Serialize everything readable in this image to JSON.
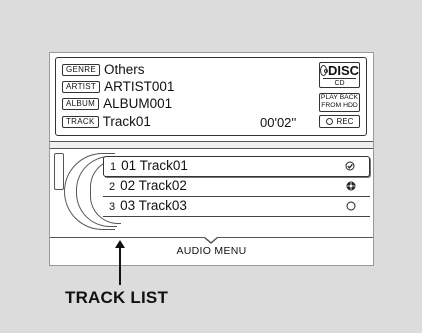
{
  "info": {
    "genre": {
      "tag": "GENRE",
      "value": "Others"
    },
    "artist": {
      "tag": "ARTIST",
      "value": "ARTIST001"
    },
    "album": {
      "tag": "ALBUM",
      "value": "ALBUM001"
    },
    "track": {
      "tag": "TRACK",
      "value": "Track01"
    },
    "time": "00'02''"
  },
  "source": {
    "disc_label": "DISC",
    "disc_sub": "CD",
    "playback_line1": "PLAY BACK",
    "playback_line2": "FROM HDD",
    "rec_label": "REC"
  },
  "track_list": [
    {
      "index": "1",
      "name": "01 Track01",
      "status_icon": "check-circle-icon",
      "selected": true
    },
    {
      "index": "2",
      "name": "02 Track02",
      "status_icon": "recorded-disc-icon",
      "selected": false
    },
    {
      "index": "3",
      "name": "03 Track03",
      "status_icon": "empty-circle-icon",
      "selected": false
    }
  ],
  "menu_label": "AUDIO MENU",
  "callout_label": "TRACK LIST"
}
